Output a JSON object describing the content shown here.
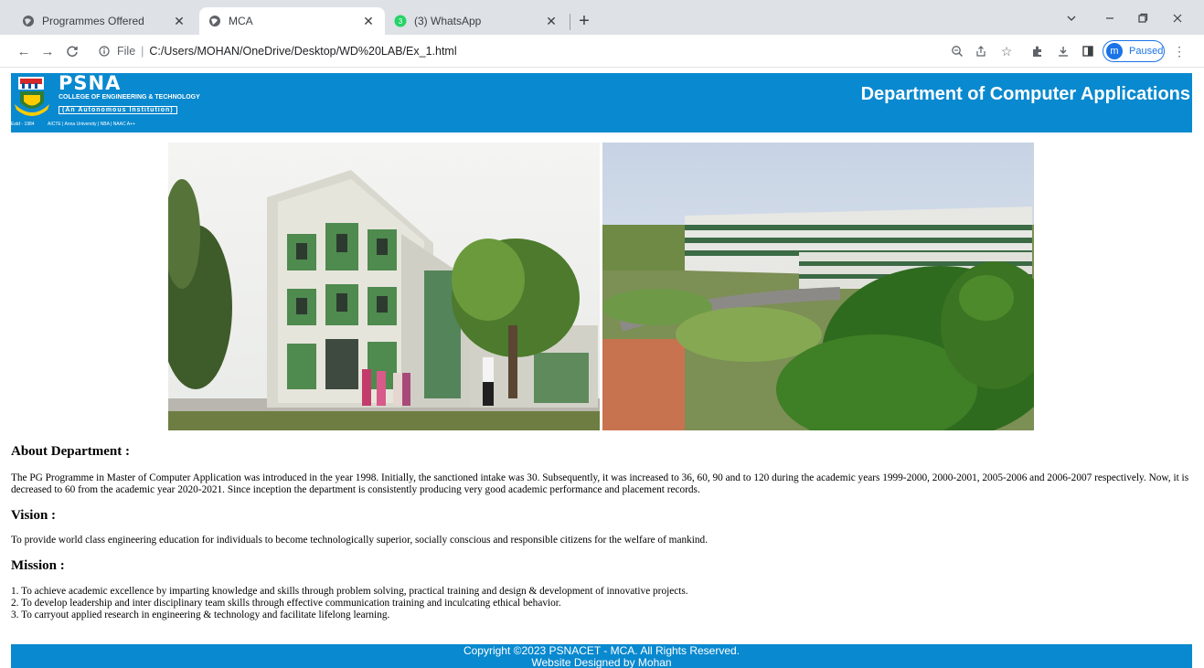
{
  "browser": {
    "tabs": [
      {
        "title": "Programmes Offered",
        "active": false
      },
      {
        "title": "MCA",
        "active": true
      },
      {
        "title": "(3) WhatsApp",
        "active": false,
        "badge": "3"
      }
    ],
    "address": {
      "scheme": "File",
      "url": "C:/Users/MOHAN/OneDrive/Desktop/WD%20LAB/Ex_1.html"
    },
    "profile": {
      "initial": "m",
      "status": "Paused"
    }
  },
  "header": {
    "logo": {
      "brand": "PSNA",
      "line1": "COLLEGE OF ENGINEERING & TECHNOLOGY",
      "line2": "(An Autonomous Institution)",
      "line3": "AICTE | Anna University | NBA | NAAC A++",
      "estd": "Estd - 1984"
    },
    "title": "Department of Computer Applications"
  },
  "about": {
    "heading": "About Department :",
    "text": "The PG Programme in Master of Computer Application was introduced in the year 1998. Initially, the sanctioned intake was 30. Subsequently, it was increased to 36, 60, 90 and to 120 during the academic years 1999-2000, 2000-2001, 2005-2006 and 2006-2007 respectively. Now, it is decreased to 60 from the academic year 2020-2021. Since inception the department is consistently producing very good academic performance and placement records."
  },
  "vision": {
    "heading": "Vision :",
    "text": "To provide world class engineering education for individuals to become technologically superior, socially conscious and responsible citizens for the welfare of mankind."
  },
  "mission": {
    "heading": "Mission :",
    "items": [
      "1. To achieve academic excellence by imparting knowledge and skills through problem solving, practical training and design & development of innovative projects.",
      "2. To develop leadership and inter disciplinary team skills through effective communication training and inculcating ethical behavior.",
      "3. To carryout applied research in engineering & technology and facilitate lifelong learning."
    ]
  },
  "footer": {
    "copyright": "Copyright ©2023 PSNACET - MCA. All Rights Reserved.",
    "designer": "Website Designed by Mohan"
  },
  "colors": {
    "header_bg": "#0989cf",
    "footer_bg": "#0989cf",
    "tabstrip_bg": "#dee1e6"
  }
}
